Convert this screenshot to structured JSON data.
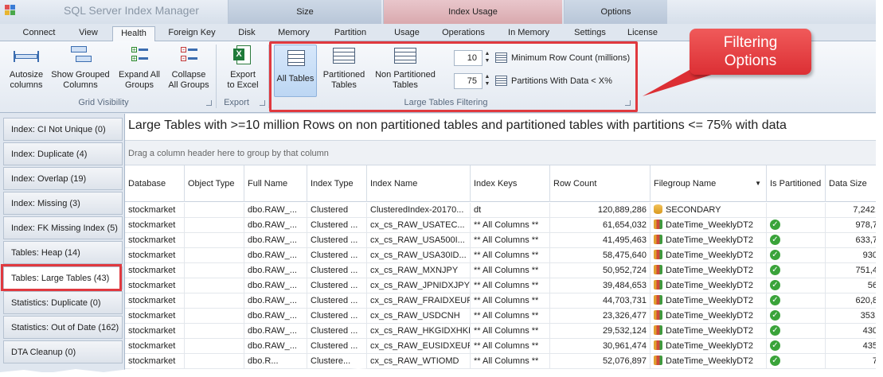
{
  "window": {
    "title": "SQL Server Index Manager"
  },
  "tab_groups": {
    "size": "Size",
    "usage": "Index Usage",
    "options": "Options"
  },
  "tabs": [
    "Connect",
    "View",
    "Health",
    "Foreign Key",
    "Disk",
    "Memory",
    "Partition",
    "Usage",
    "Operations",
    "In Memory",
    "Settings",
    "License"
  ],
  "active_tab": "Health",
  "ribbon": {
    "autosize": "Autosize\ncolumns",
    "show_grouped": "Show Grouped\nColumns",
    "expand_all": "Expand All\nGroups",
    "collapse_all": "Collapse\nAll Groups",
    "grid_visibility_label": "Grid Visibility",
    "export_excel": "Export\nto Excel",
    "export_label": "Export",
    "all_tables": "All Tables",
    "partitioned_tables": "Partitioned\nTables",
    "non_partitioned_tables": "Non Partitioned\nTables",
    "min_row_count_value": "10",
    "min_row_count_label": "Minimum Row Count (millions)",
    "partitions_value": "75",
    "partitions_label": "Partitions With Data  <  X%",
    "large_tables_filtering_label": "Large Tables Filtering"
  },
  "callout": {
    "text": "Filtering\nOptions",
    "color": "#e0393f"
  },
  "sidebar": {
    "items": [
      "Index: CI Not Unique (0)",
      "Index: Duplicate (4)",
      "Index: Overlap (19)",
      "Index: Missing (3)",
      "Index: FK Missing Index (5)",
      "Tables: Heap (14)",
      "Tables: Large Tables (43)",
      "Statistics: Duplicate (0)",
      "Statistics: Out of Date (162)",
      "DTA Cleanup (0)"
    ],
    "selected": "Tables: Large Tables (43)"
  },
  "main": {
    "title": "Large Tables with >=10 million Rows on non partitioned tables and partitioned tables with partitions  <= 75% with data",
    "group_hint": "Drag a column header here to group by that column"
  },
  "grid": {
    "columns": [
      "Database",
      "Object Type",
      "Full Name",
      "Index Type",
      "Index Name",
      "Index Keys",
      "Row Count",
      "Filegroup Name",
      "Is Partitioned",
      "Data Size"
    ],
    "rows": [
      {
        "db": "stockmarket",
        "otype": "",
        "fname": "dbo.RAW_...",
        "itype": "Clustered",
        "iname": "ClusteredIndex-20170...",
        "ikeys": "dt",
        "rows": "120,889,286",
        "fg": "SECONDARY",
        "fgkind": "db",
        "part": false,
        "size": "7,242,"
      },
      {
        "db": "stockmarket",
        "otype": "",
        "fname": "dbo.RAW_...",
        "itype": "Clustered ...",
        "iname": "cx_cs_RAW_USATEC...",
        "ikeys": "** All Columns **",
        "rows": "61,654,032",
        "fg": "DateTime_WeeklyDT2",
        "fgkind": "part",
        "part": true,
        "size": "978,7"
      },
      {
        "db": "stockmarket",
        "otype": "",
        "fname": "dbo.RAW_...",
        "itype": "Clustered ...",
        "iname": "cx_cs_RAW_USA500I...",
        "ikeys": "** All Columns **",
        "rows": "41,495,463",
        "fg": "DateTime_WeeklyDT2",
        "fgkind": "part",
        "part": true,
        "size": "633,7"
      },
      {
        "db": "stockmarket",
        "otype": "",
        "fname": "dbo.RAW_...",
        "itype": "Clustered ...",
        "iname": "cx_cs_RAW_USA30ID...",
        "ikeys": "** All Columns **",
        "rows": "58,475,640",
        "fg": "DateTime_WeeklyDT2",
        "fgkind": "part",
        "part": true,
        "size": "930"
      },
      {
        "db": "stockmarket",
        "otype": "",
        "fname": "dbo.RAW_...",
        "itype": "Clustered ...",
        "iname": "cx_cs_RAW_MXNJPY",
        "ikeys": "** All Columns **",
        "rows": "50,952,724",
        "fg": "DateTime_WeeklyDT2",
        "fgkind": "part",
        "part": true,
        "size": "751,4"
      },
      {
        "db": "stockmarket",
        "otype": "",
        "fname": "dbo.RAW_...",
        "itype": "Clustered ...",
        "iname": "cx_cs_RAW_JPNIDXJPY",
        "ikeys": "** All Columns **",
        "rows": "39,484,653",
        "fg": "DateTime_WeeklyDT2",
        "fgkind": "part",
        "part": true,
        "size": "56"
      },
      {
        "db": "stockmarket",
        "otype": "",
        "fname": "dbo.RAW_...",
        "itype": "Clustered ...",
        "iname": "cx_cs_RAW_FRAIDXEUR",
        "ikeys": "** All Columns **",
        "rows": "44,703,731",
        "fg": "DateTime_WeeklyDT2",
        "fgkind": "part",
        "part": true,
        "size": "620,8"
      },
      {
        "db": "stockmarket",
        "otype": "",
        "fname": "dbo.RAW_...",
        "itype": "Clustered ...",
        "iname": "cx_cs_RAW_USDCNH",
        "ikeys": "** All Columns **",
        "rows": "23,326,477",
        "fg": "DateTime_WeeklyDT2",
        "fgkind": "part",
        "part": true,
        "size": "353,"
      },
      {
        "db": "stockmarket",
        "otype": "",
        "fname": "dbo.RAW_...",
        "itype": "Clustered ...",
        "iname": "cx_cs_RAW_HKGIDXHKD",
        "ikeys": "** All Columns **",
        "rows": "29,532,124",
        "fg": "DateTime_WeeklyDT2",
        "fgkind": "part",
        "part": true,
        "size": "430"
      },
      {
        "db": "stockmarket",
        "otype": "",
        "fname": "dbo.RAW_...",
        "itype": "Clustered ...",
        "iname": "cx_cs_RAW_EUSIDXEUR",
        "ikeys": "** All Columns **",
        "rows": "30,961,474",
        "fg": "DateTime_WeeklyDT2",
        "fgkind": "part",
        "part": true,
        "size": "435"
      },
      {
        "db": "stockmarket",
        "otype": "",
        "fname": "dbo.R...",
        "itype": "Clustere...",
        "iname": "cx_cs_RAW_WTIOMD",
        "ikeys": "** All Columns **",
        "rows": "52,076,897",
        "fg": "DateTime_WeeklyDT2",
        "fgkind": "part",
        "part": true,
        "size": "7"
      }
    ]
  }
}
